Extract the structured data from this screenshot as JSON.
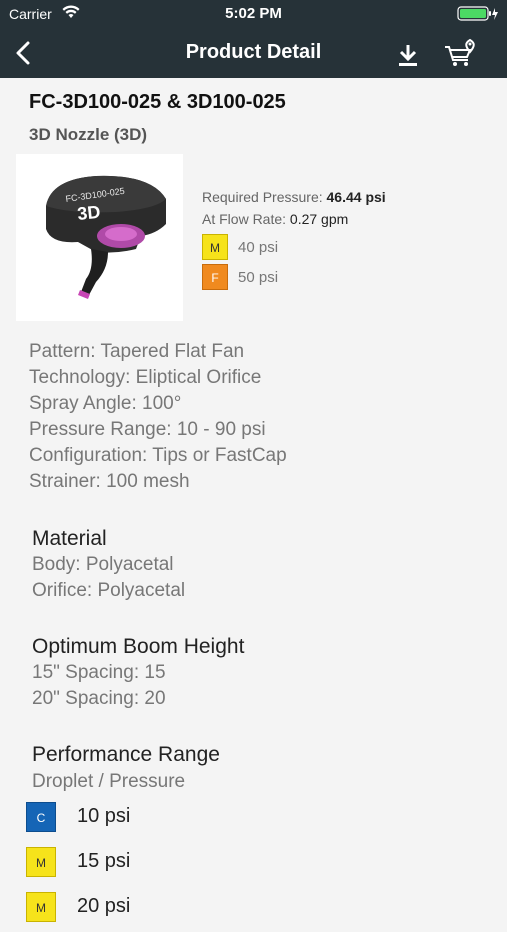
{
  "status_bar": {
    "carrier": "Carrier",
    "time": "5:02 PM"
  },
  "nav": {
    "title": "Product Detail"
  },
  "product": {
    "title": "FC-3D100-025 & 3D100-025",
    "subtitle": "3D Nozzle (3D)",
    "image_label": "FC-3D100-025",
    "image_brand": "3D",
    "required_pressure_label": "Required Pressure:",
    "required_pressure_value": "46.44 psi",
    "flow_rate_label": "At Flow Rate:",
    "flow_rate_value": "0.27 gpm",
    "droplets": [
      {
        "code": "M",
        "label": "40 psi",
        "color": "#f6e31b"
      },
      {
        "code": "F",
        "label": "50 psi",
        "color": "#f08a1f"
      }
    ]
  },
  "specs": [
    "Pattern: Tapered Flat Fan",
    "Technology: Eliptical Orifice",
    "Spray Angle: 100°",
    "Pressure Range: 10 - 90 psi",
    "Configuration: Tips or FastCap",
    "Strainer: 100 mesh"
  ],
  "material": {
    "heading": "Material",
    "lines": [
      "Body: Polyacetal",
      "Orifice: Polyacetal"
    ]
  },
  "boom_height": {
    "heading": "Optimum Boom Height",
    "lines": [
      "15\" Spacing: 15",
      "20\" Spacing: 20"
    ]
  },
  "performance": {
    "heading": "Performance Range",
    "subheading": "Droplet / Pressure",
    "rows": [
      {
        "code": "C",
        "label": "10 psi",
        "color": "#1565b6"
      },
      {
        "code": "M",
        "label": "15 psi",
        "color": "#f6e31b"
      },
      {
        "code": "M",
        "label": "20 psi",
        "color": "#f6e31b"
      }
    ]
  }
}
